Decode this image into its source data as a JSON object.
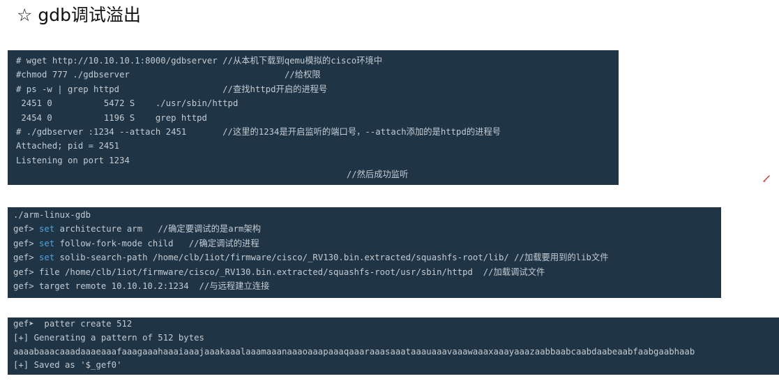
{
  "title": {
    "star": "☆",
    "text": "gdb调试溢出"
  },
  "block1": {
    "lines": [
      "# wget http://10.10.10.1:8000/gdbserver //从本机下载到qemu模拟的cisco环境中",
      "#chmod 777 ./gdbserver                              //给权限",
      "# ps -w | grep httpd                    //查找httpd开启的进程号",
      " 2451 0          5472 S    ./usr/sbin/httpd",
      " 2454 0          1196 S    grep httpd",
      "# ./gdbserver :1234 --attach 2451       //这里的1234是开启监听的端口号，--attach添加的是httpd的进程号",
      "Attached; pid = 2451",
      "Listening on port 1234",
      "                                                                //然后成功监听"
    ]
  },
  "block2": {
    "lines": [
      {
        "text": "./arm-linux-gdb"
      },
      {
        "prompt": "gef> ",
        "kw": "set",
        "rest": " architecture arm   //确定要调试的是arm架构"
      },
      {
        "prompt": "gef> ",
        "kw": "set",
        "rest": " follow-fork-mode child   //确定调试的进程"
      },
      {
        "prompt": "gef> ",
        "kw": "set",
        "rest": " solib-search-path /home/clb/1iot/firmware/cisco/_RV130.bin.extracted/squashfs-root/lib/ //加载要用到的lib文件"
      },
      {
        "text": "gef> file /home/clb/1iot/firmware/cisco/_RV130.bin.extracted/squashfs-root/usr/sbin/httpd  //加载调试文件"
      },
      {
        "text": "gef> target remote 10.10.10.2:1234  //与远程建立连接"
      }
    ]
  },
  "block3": {
    "lines": [
      "gef➤  patter create 512",
      "[+] Generating a pattern of 512 bytes",
      "aaaabaaacaaadaaaeaaafaaagaaahaaaiaaajaaakaaalaaamaaanaaaoaaapaaaqaaaraaasaaataaauaaavaaawaaaxaaayaaazaabbaabcaabdaabeaabfaabgaabhaab",
      "[+] Saved as '$_gef0'"
    ]
  },
  "icons": {
    "pen": "pen-icon"
  },
  "colors": {
    "code_background": "#1f3445",
    "code_text": "#c3ccd3",
    "keyword": "#4ea3de"
  }
}
